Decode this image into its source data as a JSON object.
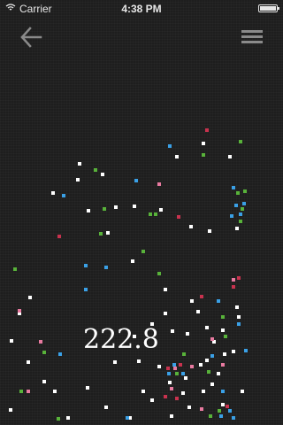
{
  "status_bar": {
    "carrier": "Carrier",
    "time": "4:38 PM",
    "battery_level": 1.0
  },
  "toolbar": {
    "back_icon": "arrow-left-icon",
    "menu_icon": "hamburger-menu-icon"
  },
  "game": {
    "score": "222.8",
    "colors": {
      "background": "#1e1e1e",
      "white": "#ffffff",
      "pink": "#e87aa0",
      "red": "#c8324e",
      "blue": "#3aa0e6",
      "green": "#58b23a"
    }
  }
}
